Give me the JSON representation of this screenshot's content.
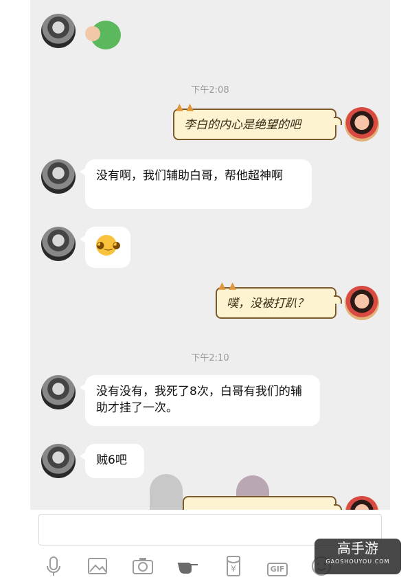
{
  "messages": [
    {
      "side": "left",
      "type": "sticker",
      "sticker": "green-dinosaur-sticker"
    },
    {
      "side": "right",
      "type": "note",
      "text": "李白的内心是绝望的吧"
    },
    {
      "side": "left",
      "type": "text",
      "text": "没有啊，我们辅助白哥，帮他超神啊"
    },
    {
      "side": "left",
      "type": "emoji",
      "emoji": "cat-blush-emoji"
    },
    {
      "side": "right",
      "type": "note",
      "text": "噗，没被打趴？"
    },
    {
      "side": "left",
      "type": "text",
      "text": "没有没有，我死了8次，白哥有我们的辅助才挂了一次。"
    },
    {
      "side": "left",
      "type": "text",
      "text": "贼6吧"
    }
  ],
  "timestamps": {
    "t1": "下午2:08",
    "t2": "下午2:10"
  },
  "input": {
    "placeholder": ""
  },
  "toolbar": {
    "icons": [
      "microphone-icon",
      "image-icon",
      "camera-icon",
      "poke-icon",
      "red-packet-icon",
      "gif-icon",
      "emoji-icon"
    ],
    "red_packet_symbol": "¥",
    "gif_label": "GIF"
  },
  "watermark": {
    "brand": "高手游",
    "domain": "GAOSHOUYOU.COM"
  },
  "colors": {
    "chat_bg": "#eeeeef",
    "bubble": "#ffffff",
    "note_bg": "#fdf3d0",
    "note_border": "#7a5a2b"
  }
}
